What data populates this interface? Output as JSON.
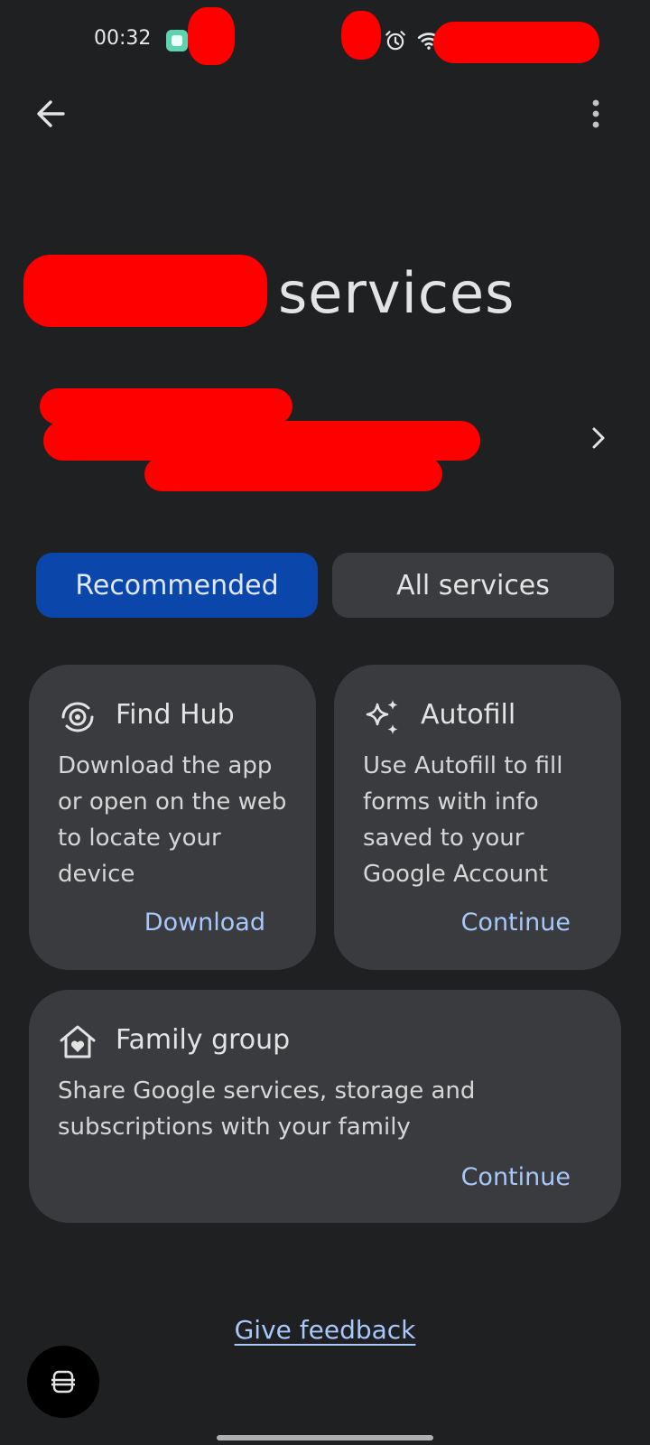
{
  "status_bar": {
    "time": "00:32",
    "icons": [
      "app-notification-icon",
      "alarm-icon",
      "wifi-icon"
    ]
  },
  "toolbar": {
    "back_icon": "arrow-left-icon",
    "menu_icon": "more-vert-icon"
  },
  "page": {
    "title": "services"
  },
  "tabs": [
    {
      "label": "Recommended",
      "selected": true
    },
    {
      "label": "All services",
      "selected": false
    }
  ],
  "cards": {
    "find_hub": {
      "icon": "find-hub-icon",
      "title": "Find Hub",
      "body": "Download the app or open on the web to locate your device",
      "action": "Download"
    },
    "autofill": {
      "icon": "sparkle-icon",
      "title": "Autofill",
      "body": "Use Autofill to fill forms with info saved to your Google Account",
      "action": "Continue"
    },
    "family_group": {
      "icon": "family-home-icon",
      "title": "Family group",
      "body": "Share Google services, storage and subscriptions with your family",
      "action": "Continue"
    }
  },
  "footer": {
    "feedback": "Give feedback"
  },
  "colors": {
    "background": "#1f2022",
    "card": "#3a3b3e",
    "tab_selected": "#0b46ab",
    "link": "#a8c7fa"
  }
}
